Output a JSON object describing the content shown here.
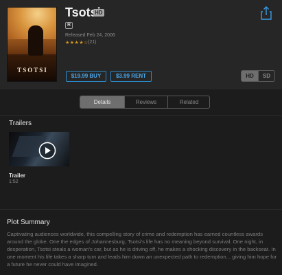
{
  "movie": {
    "title": "Tsotsi",
    "quality_badge": "HD",
    "rating": "R",
    "released": "Released Feb 24, 2006",
    "stars_display": "★★★★☆",
    "star_rating": 4,
    "review_count": "(21)",
    "poster_text": "TSOTSI"
  },
  "purchase": {
    "buy_label": "$19.99 BUY",
    "rent_label": "$3.99 RENT"
  },
  "format_toggle": {
    "options": [
      "HD",
      "SD"
    ],
    "selected": "HD"
  },
  "tabs": [
    {
      "label": "Details",
      "selected": true
    },
    {
      "label": "Reviews",
      "selected": false
    },
    {
      "label": "Related",
      "selected": false
    }
  ],
  "trailers": {
    "heading": "Trailers",
    "items": [
      {
        "label": "Trailer",
        "duration": "1:52"
      }
    ]
  },
  "plot": {
    "heading": "Plot Summary",
    "text": "Captivating audiences worldwide, this compelling story of crime and redemption has earned countless awards around the globe. One the edges of Johannesburg, Tsotsi's life has no meaning beyond survival. One night, in desperation, Tsotsi steals a woman's car, but as he is driving off, he makes a shocking discovery in the backseat. In one moment his life takes a sharp turn and leads him down an unexpected path to redemption... giving him hope for a future he never could have imagined."
  },
  "icons": {
    "share": "share-icon",
    "play": "play-icon"
  },
  "colors": {
    "accent": "#4aa8ec",
    "star": "#d79a1f",
    "background": "#1c1c1c"
  }
}
